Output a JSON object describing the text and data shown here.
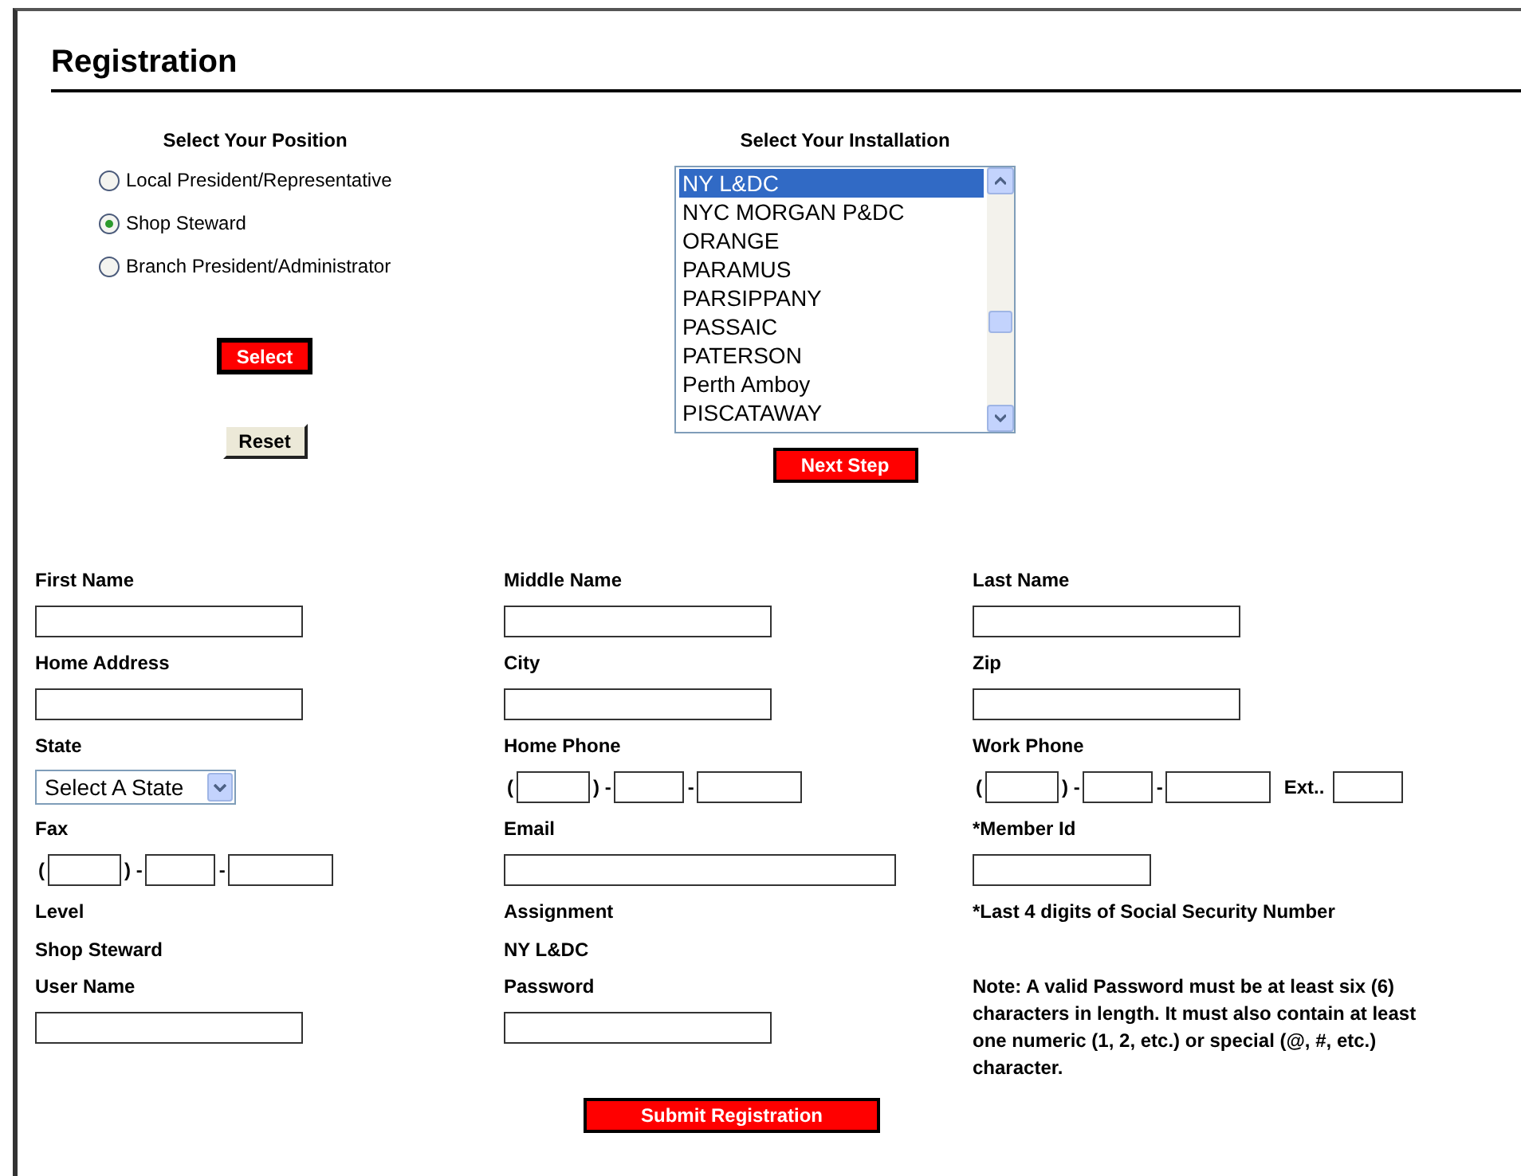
{
  "title": "Registration",
  "position": {
    "heading": "Select Your Position",
    "options": [
      {
        "label": "Local President/Representative",
        "selected": false
      },
      {
        "label": "Shop Steward",
        "selected": true
      },
      {
        "label": "Branch President/Administrator",
        "selected": false
      }
    ],
    "select_button": "Select",
    "reset_button": "Reset"
  },
  "installation": {
    "heading": "Select Your Installation",
    "items": [
      {
        "label": "NY L&DC",
        "selected": true
      },
      {
        "label": "NYC MORGAN P&DC",
        "selected": false
      },
      {
        "label": "ORANGE",
        "selected": false
      },
      {
        "label": "PARAMUS",
        "selected": false
      },
      {
        "label": "PARSIPPANY",
        "selected": false
      },
      {
        "label": "PASSAIC",
        "selected": false
      },
      {
        "label": "PATERSON",
        "selected": false
      },
      {
        "label": "Perth Amboy",
        "selected": false
      },
      {
        "label": "PISCATAWAY",
        "selected": false
      }
    ],
    "next_button": "Next Step"
  },
  "fields": [
    {
      "kind": "text",
      "label": "First Name"
    },
    {
      "kind": "text",
      "label": "Middle Name"
    },
    {
      "kind": "text",
      "label": "Last Name"
    },
    {
      "kind": "text",
      "label": "Home Address"
    },
    {
      "kind": "text",
      "label": "City"
    },
    {
      "kind": "text",
      "label": "Zip"
    },
    {
      "kind": "select",
      "label": "State",
      "value": "Select A State"
    },
    {
      "kind": "phone",
      "label": "Home Phone",
      "parts": [
        "(",
        ") -",
        "-"
      ]
    },
    {
      "kind": "phone",
      "label": "Work Phone",
      "parts": [
        "(",
        ") -",
        "-"
      ],
      "extension": "Ext.."
    },
    {
      "kind": "phone",
      "label": "Fax",
      "parts": [
        "(",
        ") -",
        "-"
      ]
    },
    {
      "kind": "wide-text",
      "label": "Email"
    },
    {
      "kind": "short-text",
      "label": "*Member Id"
    },
    {
      "kind": "static",
      "label": "Level",
      "value": "Shop Steward"
    },
    {
      "kind": "static",
      "label": "Assignment",
      "value": "NY L&DC"
    },
    {
      "kind": "note",
      "text": "*Last 4 digits of Social Security Number"
    },
    {
      "kind": "text",
      "label": "User Name"
    },
    {
      "kind": "password",
      "label": "Password"
    },
    {
      "kind": "note",
      "text": "Note: A valid Password must be at least six (6) characters in length. It must also contain at least one numeric (1, 2, etc.) or special (@, #, etc.) character."
    }
  ],
  "submit_button": "Submit Registration"
}
